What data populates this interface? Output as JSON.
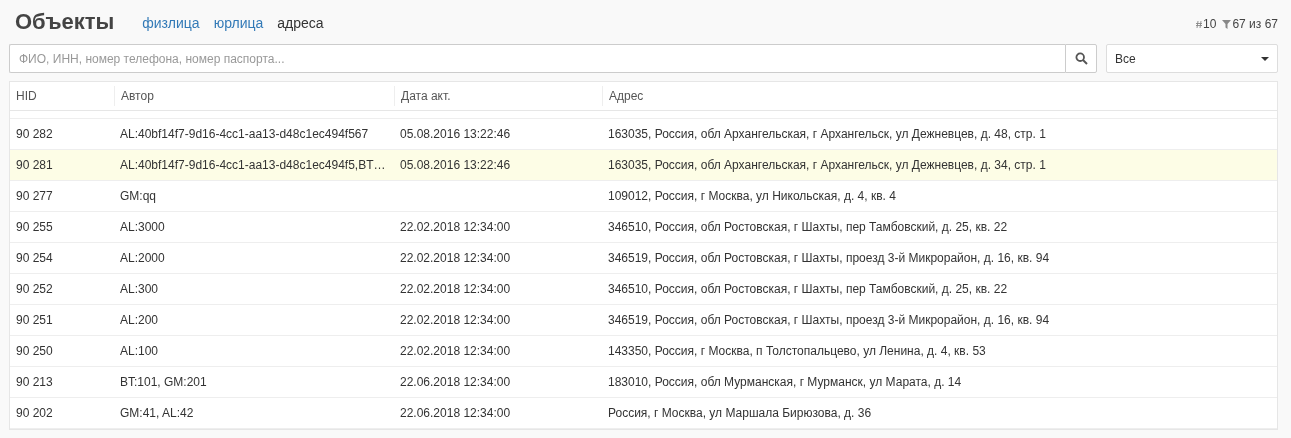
{
  "header": {
    "title": "Объекты",
    "tabs": [
      {
        "label": "физлица",
        "selected": false
      },
      {
        "label": "юрлица",
        "selected": false
      },
      {
        "label": "адреса",
        "selected": true
      }
    ],
    "page_size": "10",
    "count": "67 из 67"
  },
  "search": {
    "placeholder": "ФИО, ИНН, номер телефона, номер паспорта..."
  },
  "filter": {
    "value": "Все"
  },
  "table": {
    "columns": [
      "HID",
      "Автор",
      "Дата акт.",
      "Адрес"
    ],
    "rows": [
      {
        "hid": "90 282",
        "author": "AL:40bf14f7-9d16-4cc1-aa13-d48c1ec494f567",
        "date": "05.08.2016 13:22:46",
        "address": "163035, Россия, обл Архангельская, г Архангельск, ул Дежневцев, д. 48, стр. 1",
        "selected": false
      },
      {
        "hid": "90 281",
        "author": "AL:40bf14f7-9d16-4cc1-aa13-d48c1ec494f5,BT…",
        "date": "05.08.2016 13:22:46",
        "address": "163035, Россия, обл Архангельская, г Архангельск, ул Дежневцев, д. 34, стр. 1",
        "selected": true
      },
      {
        "hid": "90 277",
        "author": "GM:qq",
        "address": "109012, Россия, г Москва, ул Никольская, д. 4, кв. 4",
        "selected": false
      },
      {
        "hid": "90 255",
        "author": "AL:3000",
        "date": "22.02.2018 12:34:00",
        "address": "346510, Россия, обл Ростовская, г Шахты, пер Тамбовский, д. 25, кв. 22",
        "selected": false
      },
      {
        "hid": "90 254",
        "author": "AL:2000",
        "date": "22.02.2018 12:34:00",
        "address": "346519, Россия, обл Ростовская, г Шахты, проезд 3-й Микрорайон, д. 16, кв. 94",
        "selected": false
      },
      {
        "hid": "90 252",
        "author": "AL:300",
        "date": "22.02.2018 12:34:00",
        "address": "346510, Россия, обл Ростовская, г Шахты, пер Тамбовский, д. 25, кв. 22",
        "selected": false
      },
      {
        "hid": "90 251",
        "author": "AL:200",
        "date": "22.02.2018 12:34:00",
        "address": "346519, Россия, обл Ростовская, г Шахты, проезд 3-й Микрорайон, д. 16, кв. 94",
        "selected": false
      },
      {
        "hid": "90 250",
        "author": "AL:100",
        "date": "22.02.2018 12:34:00",
        "address": "143350, Россия, г Москва, п Толстопальцево, ул Ленина, д. 4, кв. 53",
        "selected": false
      },
      {
        "hid": "90 213",
        "author": "BT:101, GM:201",
        "date": "22.06.2018 12:34:00",
        "address": "183010, Россия, обл Мурманская, г Мурманск, ул Марата, д. 14",
        "selected": false
      },
      {
        "hid": "90 202",
        "author": "GM:41, AL:42",
        "date": "22.06.2018 12:34:00",
        "address": "Россия, г Москва, ул Маршала Бирюзова, д. 36",
        "selected": false
      }
    ]
  }
}
